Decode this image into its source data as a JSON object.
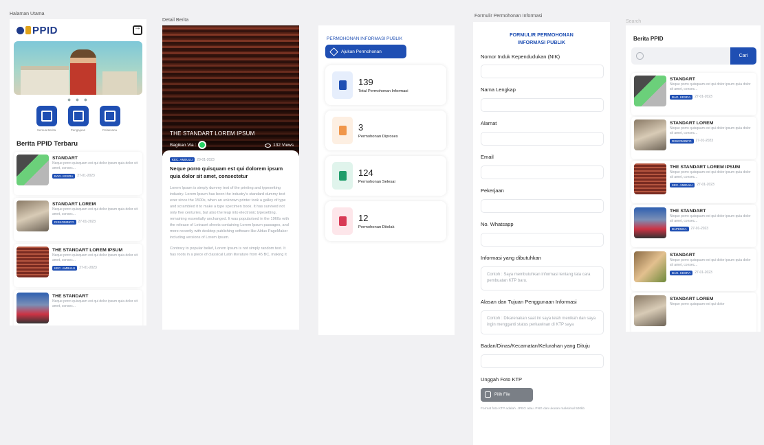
{
  "frames": {
    "home": "Halaman Utama",
    "detail": "Detail Berita",
    "form": "Formulir Permohonan Informasi",
    "search": "Search"
  },
  "home": {
    "logo": "PPID",
    "quick": [
      "Semua Berita",
      "Pengajuan",
      "Pelaksana"
    ],
    "section_title": "Berita PPID Terbaru",
    "news": [
      {
        "title": "STANDART",
        "desc": "Neque porro quisquam est qui dolor ipsum quia dolor sit amet, consec...",
        "tag": "BAG. KESRA",
        "date": "27-01-2023"
      },
      {
        "title": "STANDART LOREM",
        "desc": "Neque porro quisquam est qui dolor ipsum quia dolor sit amet, consec...",
        "tag": "DISKOMINFO",
        "date": "27-01-2023"
      },
      {
        "title": "THE STANDART LOREM IPSUM",
        "desc": "Neque porro quisquam est qui dolor ipsum quia dolor sit amet, consec...",
        "tag": "KEC. AMBULU",
        "date": "27-01-2023"
      },
      {
        "title": "THE STANDART",
        "desc": "Neque porro quisquam est qui dolor ipsum quia dolor sit amet, consec...",
        "tag": "",
        "date": ""
      }
    ]
  },
  "detail": {
    "hero_title": "THE STANDART LOREM IPSUM",
    "share": "Bagikan Via :",
    "views": "132 Views",
    "tag": "KEC. AMBULU",
    "date": "29-01-2023",
    "title": "Neque porro quisquam est qui dolorem ipsum quia dolor sit amet, consectetur",
    "p1": "Lorem Ipsum is simply dummy text of the printing and typesetting industry. Lorem Ipsum has been the industry's standard dummy text ever since the 1500s, when an unknown printer took a galley of type and scrambled it to make a type specimen book. It has survived not only five centuries, but also the leap into electronic typesetting, remaining essentially unchanged. It was popularised in the 1960s with the release of Letraset sheets containing Lorem Ipsum passages, and more recently with desktop publishing software like Aldus PageMaker including versions of Lorem Ipsum.",
    "p2": "Contrary to popular belief, Lorem Ipsum is not simply random text. It has roots in a piece of classical Latin literature from 45 BC, making it"
  },
  "permohonan": {
    "header": "PERMOHONAN INFORMASI PUBLIK",
    "button": "Ajukan Permohonan",
    "stats": [
      {
        "value": "139",
        "label": "Total Permohonan Informasi",
        "bg": "#e6eefc",
        "fg": "#1f4fb3"
      },
      {
        "value": "3",
        "label": "Permohonan Diproses",
        "bg": "#fdefe2",
        "fg": "#f0964a"
      },
      {
        "value": "124",
        "label": "Permohonan Selesai",
        "bg": "#e0f4ec",
        "fg": "#1f9d6b"
      },
      {
        "value": "12",
        "label": "Permohonan Ditolak",
        "bg": "#fde6ea",
        "fg": "#d83a55"
      }
    ]
  },
  "form": {
    "header_line1": "FORMULIR PERMOHONAN",
    "header_line2": "INFORMASI PUBLIK",
    "nik": "Nomor Induk Kependudukan (NIK)",
    "nama": "Nama Lengkap",
    "alamat": "Alamat",
    "email": "Email",
    "pekerjaan": "Pekerjaan",
    "whatsapp": "No. Whatsapp",
    "informasi": "Informasi yang dibutuhkan",
    "informasi_ph": "Contoh : Saya membutuhkan informasi tentang tata cara pembuatan KTP baru.",
    "alasan": "Alasan dan Tujuan Penggunaan Informasi",
    "alasan_ph": "Contoh : Dikarenakan saat ini saya telah menikah dan saya ingin mengganti status perkawinan di KTP saya",
    "badan": "Badan/Dinas/Kecamatan/Kelurahan yang Dituju",
    "unggah": "Unggah Foto KTP",
    "pilih": "Pilih File",
    "hint": "Format foto KTP adalah .JPEG atau .PNG dan ukuran maksimal 500kb"
  },
  "search": {
    "title": "Berita PPID",
    "placeholder": "",
    "button": "Cari",
    "news": [
      {
        "title": "STANDART",
        "desc": "Neque porro quisquam est qui dolor ipsum quia dolor sit amet, consec...",
        "tag": "BAG. KESRA",
        "date": "27-01-2023"
      },
      {
        "title": "STANDART LOREM",
        "desc": "Neque porro quisquam est qui dolor ipsum quia dolor sit amet, consec...",
        "tag": "DISKOMINFO",
        "date": "27-01-2023"
      },
      {
        "title": "THE STANDART LOREM IPSUM",
        "desc": "Neque porro quisquam est qui dolor ipsum quia dolor sit amet, consec...",
        "tag": "KEC. AMBULU",
        "date": "27-01-2023"
      },
      {
        "title": "THE STANDART",
        "desc": "Neque porro quisquam est qui dolor ipsum quia dolor sit amet, consec...",
        "tag": "BAPENDA",
        "date": "27-01-2023"
      },
      {
        "title": "STANDART",
        "desc": "Neque porro quisquam est qui dolor ipsum quia dolor sit amet, consec...",
        "tag": "BAG. KESRA",
        "date": "27-01-2023"
      },
      {
        "title": "STANDART LOREM",
        "desc": "Neque porro quisquam est qui dolor",
        "tag": "",
        "date": ""
      }
    ]
  },
  "colors": {
    "primary": "#1f4fb3",
    "background": "#f1f1f3"
  }
}
